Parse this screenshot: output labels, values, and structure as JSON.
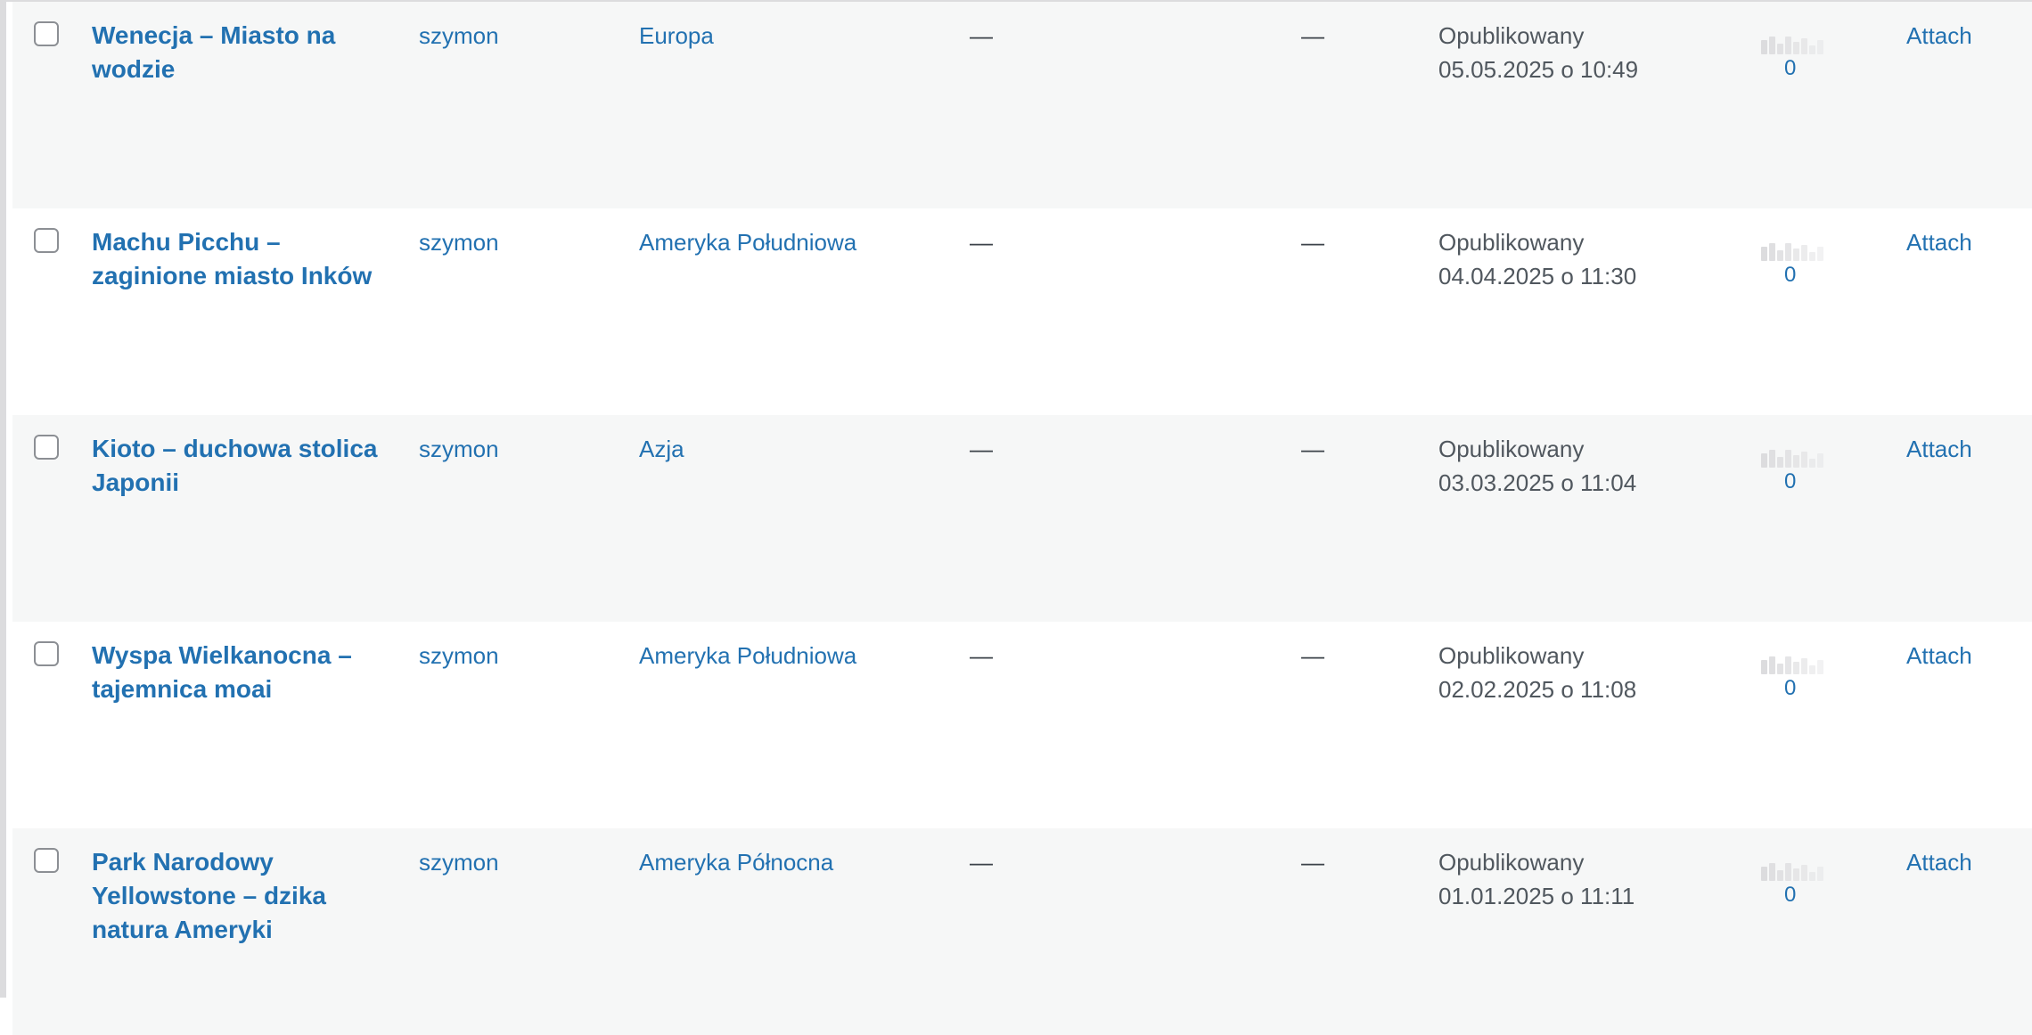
{
  "posts": [
    {
      "title": "Wenecja – Miasto na wodzie",
      "author": "szymon",
      "category": "Europa",
      "tags": "—",
      "comments": "—",
      "status": "Opublikowany",
      "date": "05.05.2025 o 10:49",
      "views": "0",
      "attach": "Attach"
    },
    {
      "title": "Machu Picchu – zaginione miasto Inków",
      "author": "szymon",
      "category": "Ameryka Południowa",
      "tags": "—",
      "comments": "—",
      "status": "Opublikowany",
      "date": "04.04.2025 o 11:30",
      "views": "0",
      "attach": "Attach"
    },
    {
      "title": "Kioto – duchowa stolica Japonii",
      "author": "szymon",
      "category": "Azja",
      "tags": "—",
      "comments": "—",
      "status": "Opublikowany",
      "date": "03.03.2025 o 11:04",
      "views": "0",
      "attach": "Attach"
    },
    {
      "title": "Wyspa Wielkanocna – tajemnica moai",
      "author": "szymon",
      "category": "Ameryka Południowa",
      "tags": "—",
      "comments": "—",
      "status": "Opublikowany",
      "date": "02.02.2025 o 11:08",
      "views": "0",
      "attach": "Attach"
    },
    {
      "title": "Park Narodowy Yellowstone – dzika natura Ameryki",
      "author": "szymon",
      "category": "Ameryka Północna",
      "tags": "—",
      "comments": "—",
      "status": "Opublikowany",
      "date": "01.01.2025 o 11:11",
      "views": "0",
      "attach": "Attach"
    }
  ],
  "colors": {
    "link": "#2271b1",
    "text": "#50575e",
    "row_alt": "#f6f7f7",
    "row_plain": "#ffffff",
    "stats_bar": "#dcdcde"
  },
  "icons": {
    "checkbox": "checkbox-icon",
    "stats": "bar-chart-icon"
  }
}
